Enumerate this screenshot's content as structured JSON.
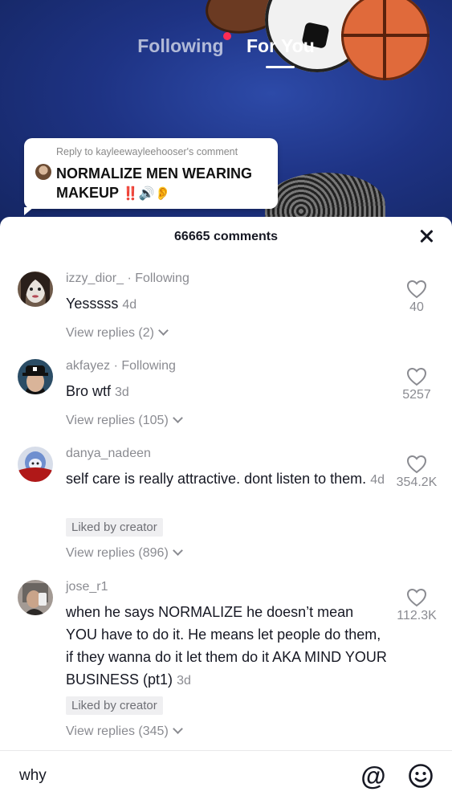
{
  "feed": {
    "tabs": [
      {
        "label": "Following",
        "active": false
      },
      {
        "label": "For You",
        "active": true
      }
    ]
  },
  "reply_card": {
    "reply_to": "Reply to kayleewayleehooser's comment",
    "text": "NORMALIZE MEN WEARING MAKEUP",
    "emoji": "‼️🔊👂"
  },
  "sheet": {
    "title": "66665 comments"
  },
  "comments": [
    {
      "username": "izzy_dior_",
      "relation": "· Following",
      "text": "Yesssss",
      "time": "4d",
      "liked_by_creator": "",
      "view_replies": "View replies (2)",
      "likes": "40"
    },
    {
      "username": "akfayez",
      "relation": "· Following",
      "text": "Bro wtf",
      "time": "3d",
      "liked_by_creator": "",
      "view_replies": "View replies (105)",
      "likes": "5257"
    },
    {
      "username": "danya_nadeen",
      "relation": "",
      "text": "self care is really attractive. dont listen to them.",
      "time": "4d",
      "liked_by_creator": "Liked by creator",
      "view_replies": "View replies (896)",
      "likes": "354.2K"
    },
    {
      "username": "jose_r1",
      "relation": "",
      "text": "when he says NORMALIZE he doesn’t mean YOU have to do it. He means let people do them, if they wanna do it let them do it AKA MIND YOUR BUSINESS (pt1)",
      "time": "3d",
      "liked_by_creator": "Liked by creator",
      "view_replies": "View replies (345)",
      "likes": "112.3K"
    }
  ],
  "input": {
    "value": "why"
  },
  "icons": {
    "mention": "at-icon",
    "emoji": "smiley-icon",
    "like": "heart-outline-icon",
    "close": "close-icon"
  },
  "colors": {
    "accent": "#fe2c55",
    "muted_text": "#8a8b91",
    "primary_text": "#161823"
  }
}
